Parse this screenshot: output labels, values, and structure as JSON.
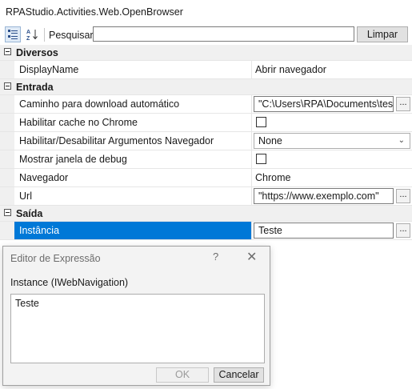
{
  "window": {
    "title": "RPAStudio.Activities.Web.OpenBrowser"
  },
  "toolbar": {
    "categorized_icon": "categorized-view-icon",
    "alphabetical_icon": "sort-alphabetical-icon",
    "search_label": "Pesquisar:",
    "search_value": "",
    "clear_label": "Limpar"
  },
  "grid": {
    "categories": [
      {
        "name": "Diversos"
      },
      {
        "name": "Entrada"
      },
      {
        "name": "Saída"
      }
    ],
    "diversos": {
      "display_name": {
        "label": "DisplayName",
        "value": "Abrir navegador"
      }
    },
    "entrada": {
      "download_path": {
        "label": "Caminho para download automático",
        "value": "\"C:\\Users\\RPA\\Documents\\teste\""
      },
      "chrome_cache": {
        "label": "Habilitar cache no Chrome",
        "checked": false
      },
      "browser_args": {
        "label": "Habilitar/Desabilitar Argumentos Navegador",
        "value": "None"
      },
      "debug_window": {
        "label": "Mostrar janela de debug",
        "checked": false
      },
      "browser": {
        "label": "Navegador",
        "value": "Chrome"
      },
      "url": {
        "label": "Url",
        "value": "\"https://www.exemplo.com\""
      }
    },
    "saida": {
      "instance": {
        "label": "Instância",
        "value": "Teste"
      }
    },
    "ellipsis": "..."
  },
  "dialog": {
    "title": "Editor de Expressão",
    "help": "?",
    "close": "✕",
    "type_label": "Instance (IWebNavigation)",
    "expression": "Teste",
    "ok_label": "OK",
    "cancel_label": "Cancelar"
  },
  "colors": {
    "selection": "#0078d7",
    "category_bg": "#f0f0f0"
  }
}
